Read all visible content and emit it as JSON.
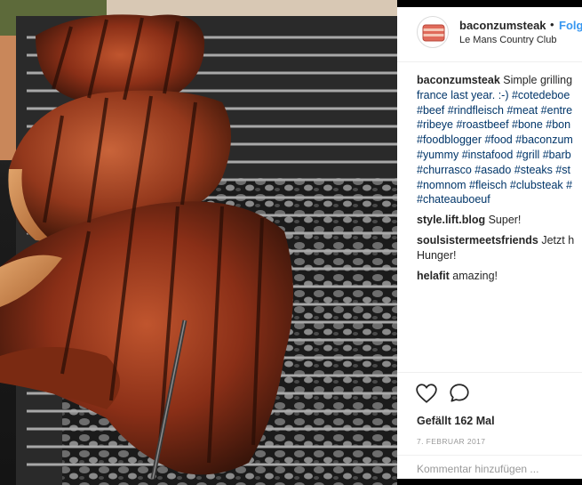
{
  "post": {
    "image_description_icon": "grilled-steaks-photo",
    "header": {
      "username": "baconzumsteak",
      "separator": "•",
      "follow_label": "Folg",
      "location": "Le Mans Country Club"
    },
    "caption": {
      "username": "baconzumsteak",
      "lines": [
        "Simple grilling",
        "france last year. :-) #cotedeboe",
        "#beef #rindfleisch #meat #entre",
        "#ribeye #roastbeef #bone #bon",
        "#foodblogger #food #baconzum",
        "#yummy #instafood #grill #barb",
        "#churrasco #asado #steaks #st",
        "#nomnom #fleisch #clubsteak #",
        "#chateauboeuf"
      ]
    },
    "comments": [
      {
        "username": "style.lift.blog",
        "lines": [
          "Super!"
        ]
      },
      {
        "username": "soulsistermeetsfriends",
        "lines": [
          "Jetzt h",
          "Hunger!"
        ]
      },
      {
        "username": "helafit",
        "lines": [
          "amazing!"
        ]
      }
    ],
    "likes": "Gefällt 162 Mal",
    "date": "7. FEBRUAR 2017",
    "comment_placeholder": "Kommentar hinzufügen ...",
    "colors": {
      "link_blue": "#3897f0",
      "hashtag": "#003569",
      "text": "#262626",
      "muted": "#999999"
    }
  }
}
